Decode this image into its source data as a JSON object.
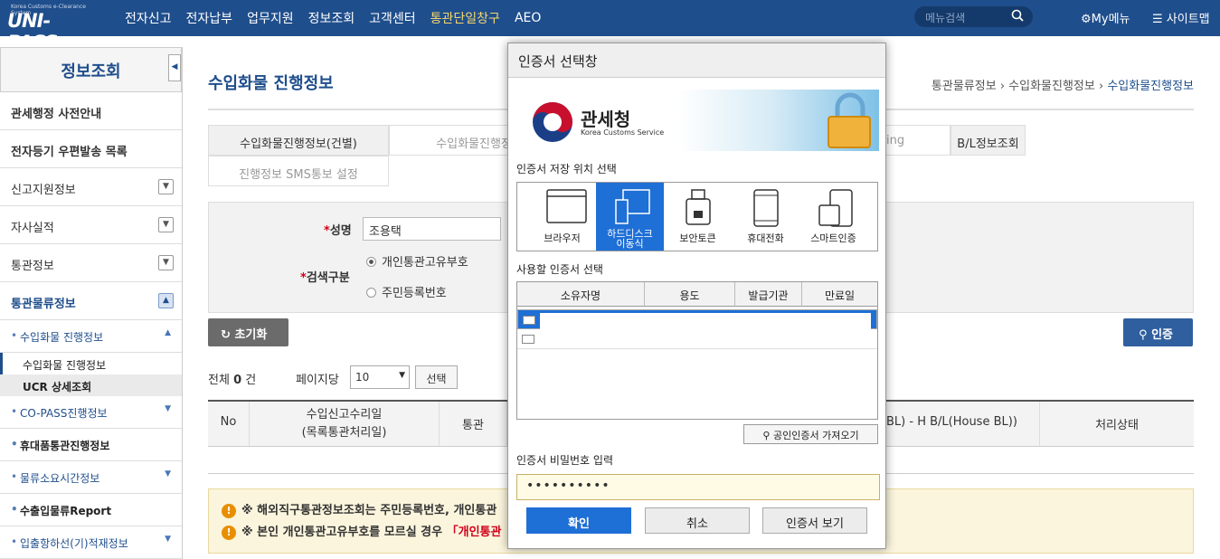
{
  "header": {
    "logo_sub": "Korea Customs e-Clearance System",
    "logo": "UNI-PASS",
    "nav": [
      "전자신고",
      "전자납부",
      "업무지원",
      "정보조회",
      "고객센터",
      "통관단일창구",
      "AEO"
    ],
    "search_placeholder": "메뉴검색",
    "mymenu": "My메뉴",
    "sitemap": "사이트맵"
  },
  "sidebar": {
    "title": "정보조회",
    "items": [
      "관세행정 사전안내",
      "전자등기 우편발송 목록",
      "신고지원정보",
      "자사실적",
      "통관정보",
      "통관물류정보"
    ],
    "sub": [
      "수입화물 진행정보",
      "수입화물 진행정보",
      "UCR 상세조회",
      "CO-PASS진행정보",
      "휴대품통관진행정보",
      "물류소요시간정보",
      "수출입물류Report",
      "입출항하선(기)적재정보"
    ]
  },
  "main": {
    "title": "수입화물 진행정보",
    "breadcrumb": [
      "통관물류정보",
      "수입화물진행정보",
      "수입화물진행정보"
    ],
    "tabs": [
      "수입화물진행정보(건별)",
      "수입화물진행정보",
      "ing",
      "B/L정보조회",
      "진행정보 SMS통보 설정"
    ],
    "form": {
      "name_label": "성명",
      "name_value": "조용택",
      "search_type_label": "검색구분",
      "radio1": "개인통관고유부호",
      "radio2": "주민등록번호"
    },
    "reset_label": "초기화",
    "auth_label": "인증",
    "count_prefix": "전체",
    "count_value": "0",
    "count_suffix": "건",
    "perpage_label": "페이지당",
    "perpage_value": "10",
    "select_button": "선택",
    "table_headers": [
      "No",
      "수입신고수리일",
      "(목록통관처리일)",
      "통관",
      "BL) - H B/L(House BL))",
      "처리상태"
    ],
    "notice1": "※ 해외직구통관정보조회는 주민등록번호, 개인통관",
    "notice2_a": "※ 본인 개인통관고유부호를 모르실 경우",
    "notice2_b": "「개인통관"
  },
  "modal": {
    "title": "인증서 선택창",
    "kcs_name": "관세청",
    "kcs_eng": "Korea Customs Service",
    "storage_label": "인증서 저장 위치 선택",
    "storage": [
      "브라우저",
      "하드디스크",
      "이동식",
      "보안토큰",
      "휴대전화",
      "스마트인증"
    ],
    "cert_label": "사용할 인증서 선택",
    "cert_columns": [
      "소유자명",
      "용도",
      "발급기관",
      "만료일"
    ],
    "import_button": "공인인증서 가져오기",
    "password_label": "인증서 비밀번호 입력",
    "password_value": "••••••••••",
    "buttons": [
      "확인",
      "취소",
      "인증서 보기"
    ]
  },
  "colors": {
    "brand": "#1f4e8c",
    "accent": "#1e6fd6",
    "highlight": "#f5d86c"
  }
}
